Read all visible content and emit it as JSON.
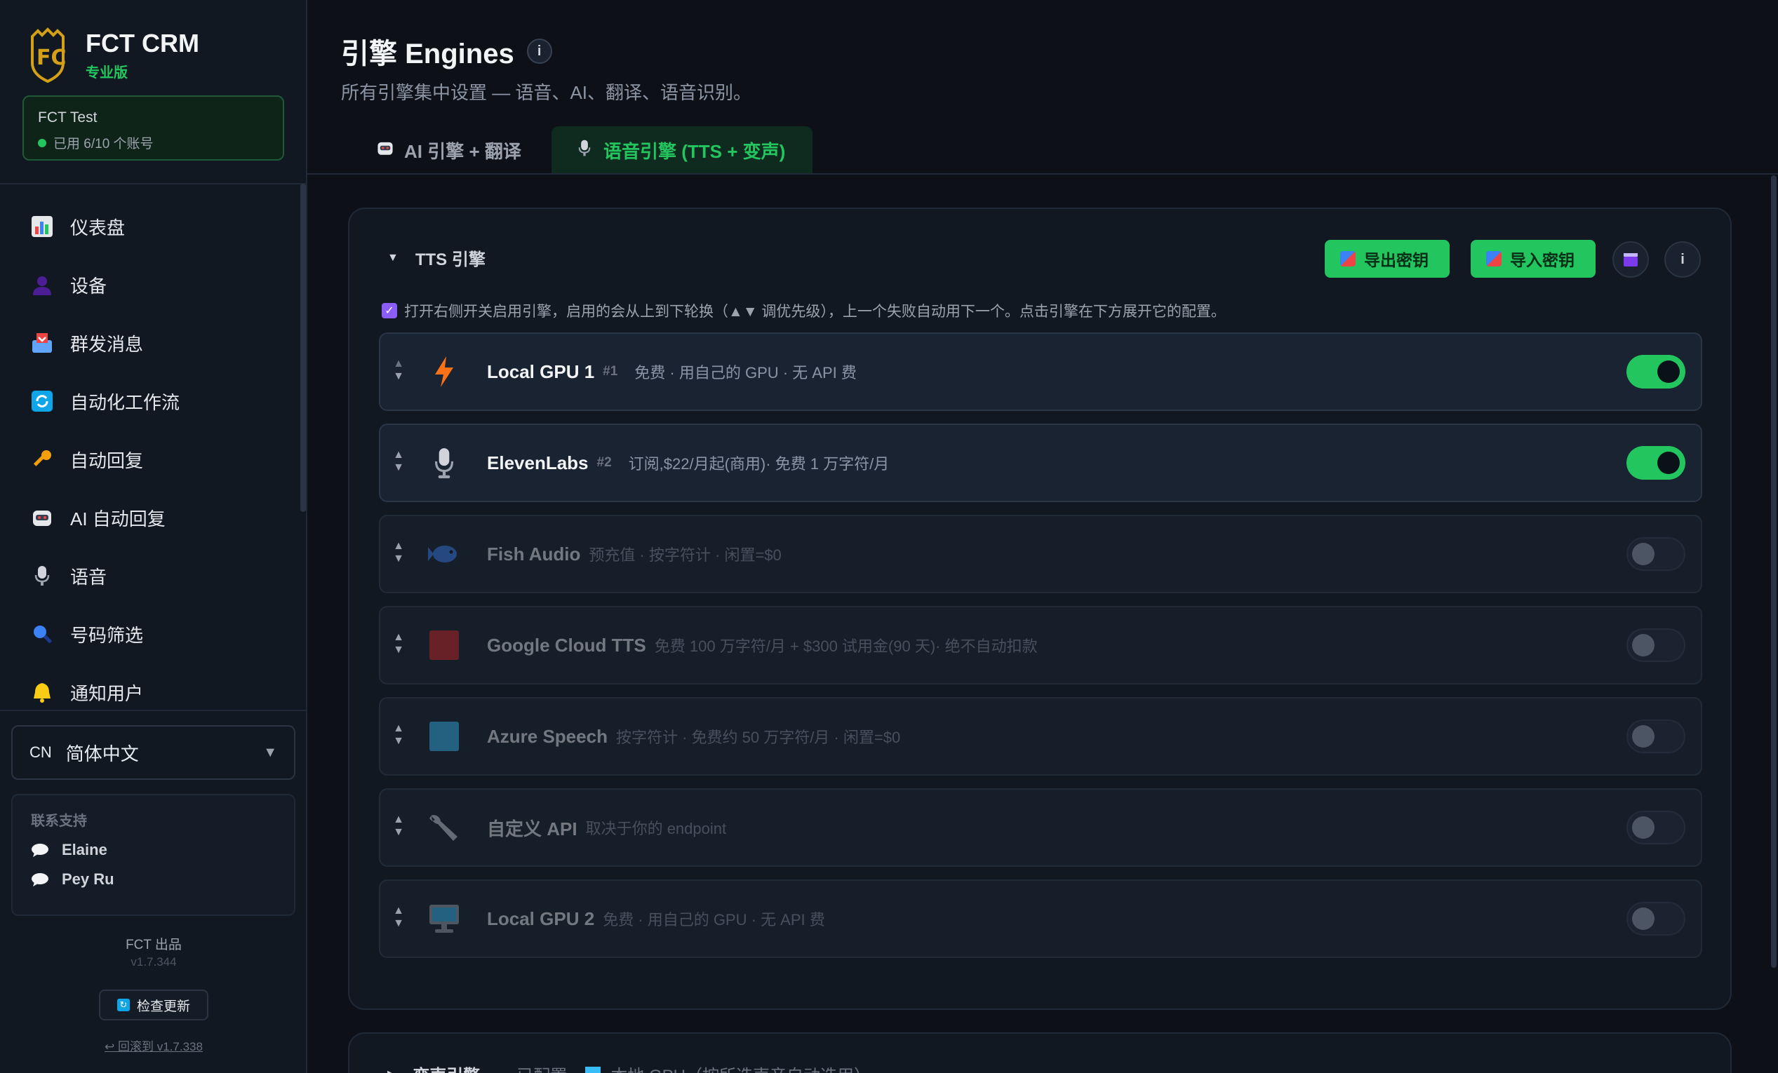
{
  "brand": {
    "name": "FCT CRM",
    "edition": "专业版"
  },
  "account": {
    "name": "FCT Test",
    "usage": "已用 6/10 个账号"
  },
  "nav": [
    {
      "label": "仪表盘",
      "icon": "bar-chart-icon"
    },
    {
      "label": "设备",
      "icon": "user-silhouette-icon"
    },
    {
      "label": "群发消息",
      "icon": "inbox-tray-icon"
    },
    {
      "label": "自动化工作流",
      "icon": "refresh-icon"
    },
    {
      "label": "自动回复",
      "icon": "key-icon"
    },
    {
      "label": "AI 自动回复",
      "icon": "robot-icon"
    },
    {
      "label": "语音",
      "icon": "microphone-icon"
    },
    {
      "label": "号码筛选",
      "icon": "magnifier-icon"
    },
    {
      "label": "通知用户",
      "icon": "bell-icon"
    }
  ],
  "language": {
    "code": "CN",
    "label": "简体中文"
  },
  "support": {
    "title": "联系支持",
    "contacts": [
      "Elaine",
      "Pey Ru"
    ]
  },
  "footer": {
    "by": "FCT 出品",
    "version": "v1.7.344",
    "update_label": "检查更新",
    "rollback": "↩ 回滚到 v1.7.338"
  },
  "page": {
    "title": "引擎 Engines",
    "info": "i",
    "subtitle": "所有引擎集中设置 — 语音、AI、翻译、语音识别。"
  },
  "tabs": [
    {
      "label": "AI 引擎 + 翻译",
      "icon": "robot-icon",
      "active": false
    },
    {
      "label": "语音引擎 (TTS + 变声)",
      "icon": "microphone-icon",
      "active": true
    }
  ],
  "tts": {
    "title": "TTS 引擎",
    "export_label": "导出密钥",
    "import_label": "导入密钥",
    "info": "i",
    "notice": "打开右侧开关启用引擎，启用的会从上到下轮换（▲▼ 调优先级），上一个失败自动用下一个。点击引擎在下方展开它的配置。",
    "engines": [
      {
        "name": "Local GPU 1",
        "rank": "#1",
        "desc": "免费 · 用自己的 GPU · 无 API 费",
        "icon": "lightning-icon",
        "enabled": true
      },
      {
        "name": "ElevenLabs",
        "rank": "#2",
        "desc": "订阅,$22/月起(商用)· 免费 1 万字符/月",
        "icon": "microphone-icon",
        "enabled": true
      },
      {
        "name": "Fish Audio",
        "rank": "",
        "desc": "预充值 · 按字符计 · 闲置=$0",
        "icon": "fish-icon",
        "enabled": false
      },
      {
        "name": "Google Cloud TTS",
        "rank": "",
        "desc": "免费 100 万字符/月 + $300 试用金(90 天)· 绝不自动扣款",
        "icon": "red-square-icon",
        "enabled": false
      },
      {
        "name": "Azure Speech",
        "rank": "",
        "desc": "按字符计 · 免费约 50 万字符/月 · 闲置=$0",
        "icon": "blue-square-icon",
        "enabled": false
      },
      {
        "name": "自定义 API",
        "rank": "",
        "desc": "取决于你的 endpoint",
        "icon": "wrench-icon",
        "enabled": false
      },
      {
        "name": "Local GPU 2",
        "rank": "",
        "desc": "免费 · 用自己的 GPU · 无 API 费",
        "icon": "monitor-icon",
        "enabled": false
      }
    ]
  },
  "voice_changer": {
    "title": "变声引擎",
    "status": "已配置",
    "desc": "本地 GPU（按所选声音自动选用）"
  },
  "colors": {
    "accent": "#22c55e",
    "background": "#0d1117",
    "sidebar": "#111822"
  }
}
